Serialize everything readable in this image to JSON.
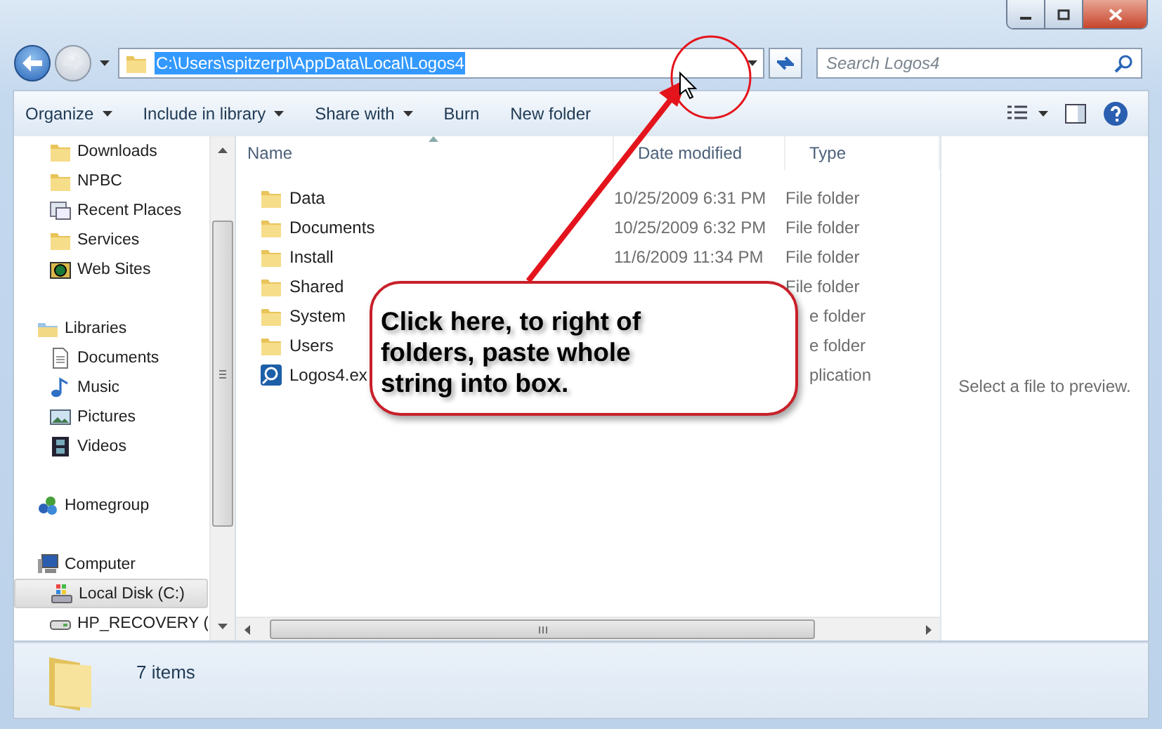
{
  "address_bar": {
    "path": "C:\\Users\\spitzerpl\\AppData\\Local\\Logos4",
    "selected": true
  },
  "search": {
    "placeholder": "Search Logos4"
  },
  "toolbar": [
    {
      "label": "Organize",
      "menu": true
    },
    {
      "label": "Include in library",
      "menu": true
    },
    {
      "label": "Share with",
      "menu": true
    },
    {
      "label": "Burn",
      "menu": false
    },
    {
      "label": "New folder",
      "menu": false
    }
  ],
  "sidebar": {
    "items": [
      {
        "children": [
          {
            "label": "Downloads",
            "kind": "folder",
            "selected": false
          },
          {
            "label": "NPBC",
            "kind": "folder",
            "selected": false
          },
          {
            "label": "Recent Places",
            "kind": "recent",
            "selected": false
          },
          {
            "label": "Services",
            "kind": "folder",
            "selected": false
          },
          {
            "label": "Web Sites",
            "kind": "website",
            "selected": false
          }
        ]
      },
      {
        "label": "Libraries",
        "kind": "library",
        "selected": false,
        "children": [
          {
            "label": "Documents",
            "kind": "document",
            "selected": false
          },
          {
            "label": "Music",
            "kind": "music",
            "selected": false
          },
          {
            "label": "Pictures",
            "kind": "picture",
            "selected": false
          },
          {
            "label": "Videos",
            "kind": "video",
            "selected": false
          }
        ]
      },
      {
        "label": "Homegroup",
        "kind": "homegroup",
        "selected": false
      },
      {
        "label": "Computer",
        "kind": "computer",
        "selected": false,
        "children": [
          {
            "label": "Local Disk (C:)",
            "kind": "system-drive",
            "selected": true
          },
          {
            "label": "HP_RECOVERY (",
            "kind": "drive",
            "selected": false
          }
        ]
      }
    ]
  },
  "file_list": {
    "columns": [
      "Name",
      "Date modified",
      "Type"
    ],
    "rows": [
      {
        "name": "Data",
        "kind": "folder",
        "date": "10/25/2009 6:31 PM",
        "type": "File folder",
        "type_cut": false
      },
      {
        "name": "Documents",
        "kind": "folder",
        "date": "10/25/2009 6:32 PM",
        "type": "File folder",
        "type_cut": false
      },
      {
        "name": "Install",
        "kind": "folder",
        "date": "11/6/2009 11:34 PM",
        "type": "File folder",
        "type_cut": false
      },
      {
        "name": "Shared",
        "kind": "folder",
        "type": "File folder",
        "type_cut": false
      },
      {
        "name": "System",
        "kind": "folder",
        "type": "e folder",
        "type_cut": true
      },
      {
        "name": "Users",
        "kind": "folder",
        "type": "e folder",
        "type_cut": true
      },
      {
        "name": "Logos4.ex",
        "kind": "application",
        "type": "plication",
        "type_cut": true
      }
    ]
  },
  "preview": {
    "message": "Select a file to preview."
  },
  "status_bar": {
    "count": "7 items"
  },
  "callout": {
    "text": "Click here, to right of folders, paste whole string into box."
  }
}
